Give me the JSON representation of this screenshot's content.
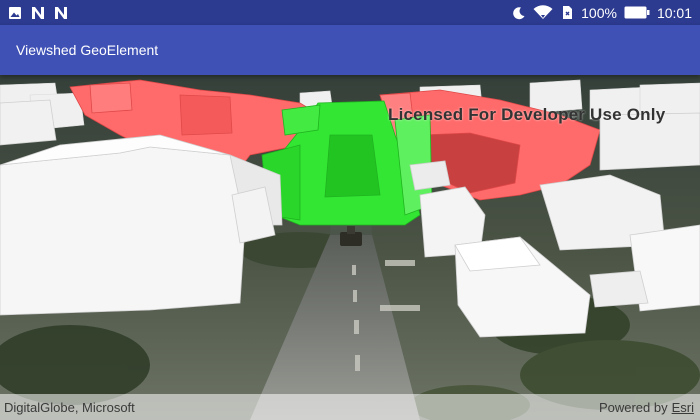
{
  "status_bar": {
    "left_icons": [
      "image-notification-icon",
      "n-notification-icon",
      "n-notification-icon"
    ],
    "right_icons": [
      "do-not-disturb-moon-icon",
      "wifi-icon",
      "sim-no-signal-icon"
    ],
    "battery_percent": "100%",
    "time": "10:01"
  },
  "app_bar": {
    "title": "Viewshed GeoElement"
  },
  "map": {
    "watermark": "Licensed For Developer Use Only",
    "attribution_left": "DigitalGlobe, Microsoft",
    "powered_by": "Powered by",
    "esri": "Esri",
    "colors": {
      "visible": "#2ee52e",
      "not_visible": "#ff5c5c",
      "buildings": "#f2f2f2"
    }
  }
}
